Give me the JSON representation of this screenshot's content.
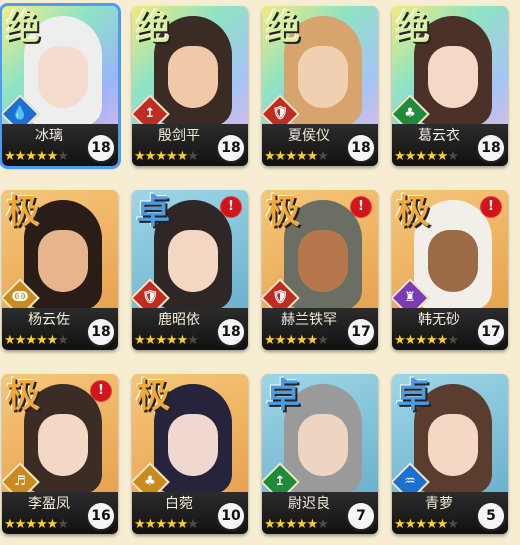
{
  "heroes": [
    {
      "grade": "绝",
      "name": "冰璃",
      "level": "18",
      "stars": 5,
      "alert": false,
      "cls": "💧",
      "cls_color": "#1d6fd0",
      "bg": "linear-gradient(135deg,#f5ee80,#8fe3c5,#9ab5f7,#f5b6e6)",
      "hair": "#eeeeef",
      "skin": "#f5dccd",
      "grade_class": "g1",
      "selected": true
    },
    {
      "grade": "绝",
      "name": "殷剑平",
      "level": "18",
      "stars": 5,
      "alert": false,
      "cls": "↥",
      "cls_color": "#c02b22",
      "bg": "linear-gradient(135deg,#f3ea7a,#8fe3c5,#a5c4f5,#f3b9e0)",
      "hair": "#3a2c25",
      "skin": "#f1c9a8",
      "grade_class": "g1",
      "selected": false
    },
    {
      "grade": "绝",
      "name": "夏侯仪",
      "level": "18",
      "stars": 5,
      "alert": false,
      "cls": "🛡",
      "cls_color": "#c02b22",
      "bg": "linear-gradient(135deg,#f3ea7a,#8fe3c5,#a5c4f5,#f3b9e0)",
      "hair": "#d7a46d",
      "skin": "#f1d0b2",
      "grade_class": "g1",
      "selected": false
    },
    {
      "grade": "绝",
      "name": "葛云衣",
      "level": "18",
      "stars": 5,
      "alert": false,
      "cls": "♣",
      "cls_color": "#1f8a3a",
      "bg": "linear-gradient(135deg,#f3ea7a,#8fe3c5,#a5c4f5,#f3b9e0)",
      "hair": "#4b3127",
      "skin": "#f4d9c6",
      "grade_class": "g1",
      "selected": false
    },
    {
      "grade": "极",
      "name": "杨云佐",
      "level": "18",
      "stars": 5,
      "alert": false,
      "cls": "ↂ",
      "cls_color": "#c98b1f",
      "bg": "linear-gradient(160deg,#f6c679,#e39a45)",
      "hair": "#2a1d18",
      "skin": "#e7b48b",
      "grade_class": "g2",
      "selected": false
    },
    {
      "grade": "卓",
      "name": "鹿昭依",
      "level": "18",
      "stars": 5,
      "alert": true,
      "cls": "🛡",
      "cls_color": "#c02b22",
      "bg": "linear-gradient(160deg,#9ed6e6,#5fa8c7)",
      "hair": "#2f2626",
      "skin": "#f4d7c3",
      "grade_class": "g3",
      "selected": false
    },
    {
      "grade": "极",
      "name": "赫兰铁罕",
      "level": "17",
      "stars": 5,
      "alert": true,
      "cls": "🛡",
      "cls_color": "#c02b22",
      "bg": "linear-gradient(160deg,#f6c679,#e39a45)",
      "hair": "#6b6f63",
      "skin": "#b7774c",
      "grade_class": "g2",
      "selected": false
    },
    {
      "grade": "极",
      "name": "韩无砂",
      "level": "17",
      "stars": 5,
      "alert": true,
      "cls": "♜",
      "cls_color": "#7a3bb4",
      "bg": "linear-gradient(160deg,#f6c679,#e39a45)",
      "hair": "#f2efe8",
      "skin": "#9c6a45",
      "grade_class": "g2",
      "selected": false
    },
    {
      "grade": "极",
      "name": "李盈凤",
      "level": "16",
      "stars": 5,
      "alert": true,
      "cls": "♬",
      "cls_color": "#c98b1f",
      "bg": "linear-gradient(160deg,#f6c679,#e39a45)",
      "hair": "#3c2c26",
      "skin": "#f4d8c6",
      "grade_class": "g2",
      "selected": false
    },
    {
      "grade": "极",
      "name": "白菀",
      "level": "10",
      "stars": 5,
      "alert": false,
      "cls": "♣",
      "cls_color": "#c98b1f",
      "bg": "linear-gradient(160deg,#f6c679,#e39a45)",
      "hair": "#26233d",
      "skin": "#f0d8d0",
      "grade_class": "g2",
      "selected": false
    },
    {
      "grade": "卓",
      "name": "尉迟良",
      "level": "7",
      "stars": 5,
      "alert": false,
      "cls": "↥",
      "cls_color": "#1f8a3a",
      "bg": "linear-gradient(160deg,#9ed6e6,#5fa8c7)",
      "hair": "#9a9a9a",
      "skin": "#edd5c2",
      "grade_class": "g3",
      "selected": false
    },
    {
      "grade": "卓",
      "name": "青萝",
      "level": "5",
      "stars": 5,
      "alert": false,
      "cls": "♒",
      "cls_color": "#1d6fd0",
      "bg": "linear-gradient(160deg,#9ed6e6,#5fa8c7)",
      "hair": "#5b3d2f",
      "skin": "#f3d8c4",
      "grade_class": "g3",
      "selected": false
    }
  ]
}
